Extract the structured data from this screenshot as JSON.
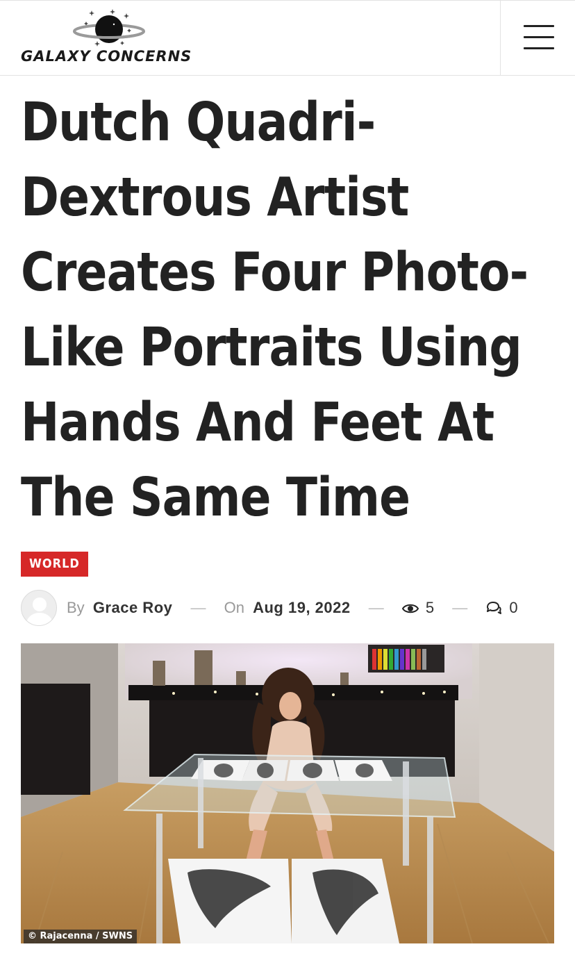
{
  "site": {
    "name": "GALAXY CONCERNS",
    "menu_icon": "hamburger-menu-icon"
  },
  "article": {
    "title": "Dutch Quadri-Dextrous Artist Creates Four Photo-Like Portraits Using Hands And Feet At The Same Time",
    "category": "WORLD",
    "author_prefix": "By",
    "author": "Grace Roy",
    "date_prefix": "On",
    "date": "Aug 19, 2022",
    "views": "5",
    "comments": "0",
    "separator": "—",
    "image_credit": "© Rajacenna / SWNS"
  },
  "colors": {
    "category_badge": "#d62828",
    "text": "#222222",
    "muted": "#999999"
  }
}
